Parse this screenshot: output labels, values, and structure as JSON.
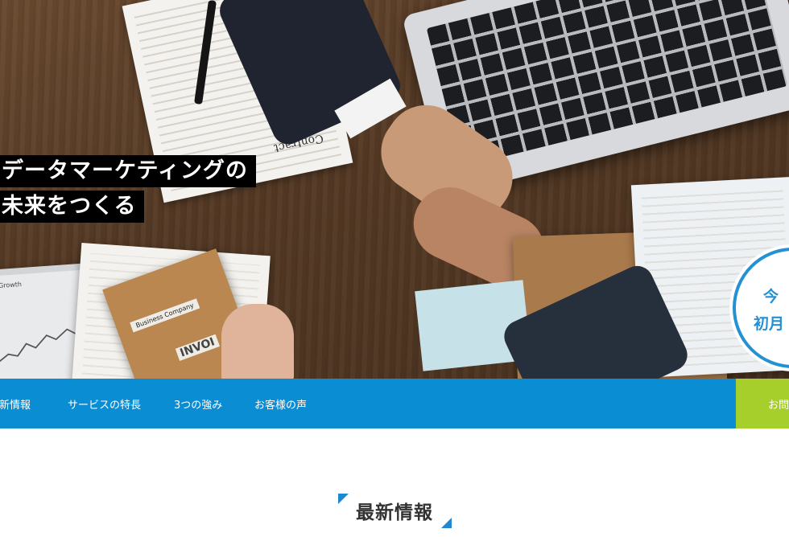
{
  "hero": {
    "copy_line1": "データマーケティングの",
    "copy_line2": "未来をつくる",
    "badge_line1": "今",
    "badge_line2": "初月",
    "photo_labels": {
      "contract": "Contract",
      "company": "Business Company",
      "invoice": "INVOI",
      "growth": "Growth"
    }
  },
  "nav": {
    "items": [
      "最新情報",
      "サービスの特長",
      "3つの強み",
      "お客様の声"
    ],
    "cta": "お問"
  },
  "section": {
    "title": "最新情報"
  },
  "colors": {
    "nav_bg": "#0a8dd3",
    "cta_bg": "#a6cf2b",
    "accent": "#1e88d0"
  }
}
